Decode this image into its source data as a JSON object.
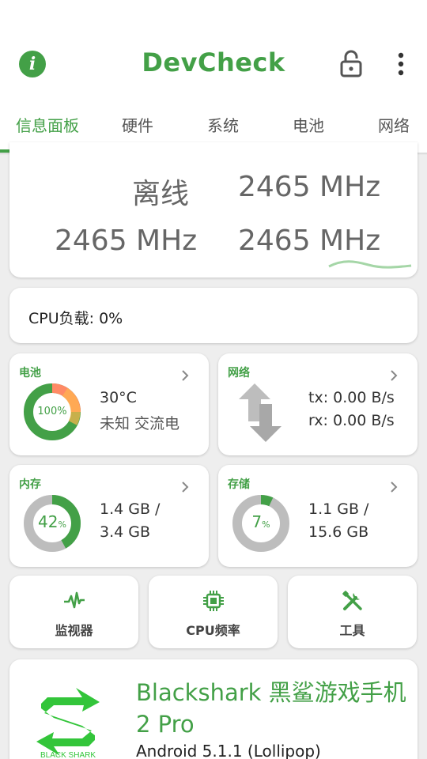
{
  "app": {
    "title": "DevCheck"
  },
  "toolbar": {
    "info_icon": "info-icon",
    "lock_icon": "lock-icon",
    "more_icon": "more-vert-icon"
  },
  "tabs": [
    {
      "label": "信息面板",
      "active": true
    },
    {
      "label": "硬件"
    },
    {
      "label": "系统"
    },
    {
      "label": "电池"
    },
    {
      "label": "网络"
    }
  ],
  "cpu_freq": {
    "cells": [
      "离线",
      "2465 MHz",
      "2465 MHz",
      "2465 MHz"
    ]
  },
  "cpu_load": {
    "text": "CPU负载: 0%"
  },
  "battery": {
    "label": "电池",
    "percent_text": "100%",
    "percent": 100,
    "temp": "30°C",
    "status": "未知 交流电"
  },
  "network": {
    "label": "网络",
    "tx": "tx: 0.00 B/s",
    "rx": "rx: 0.00 B/s"
  },
  "memory": {
    "label": "内存",
    "percent": 42,
    "percent_text": "42",
    "used": "1.4 GB /",
    "total": "3.4 GB"
  },
  "storage": {
    "label": "存储",
    "percent": 7,
    "percent_text": "7",
    "used": "1.1 GB /",
    "total": "15.6 GB"
  },
  "tools": [
    {
      "label": "监视器",
      "icon": "monitor-pulse-icon"
    },
    {
      "label": "CPU频率",
      "icon": "cpu-chip-icon"
    },
    {
      "label": "工具",
      "icon": "tools-icon"
    }
  ],
  "device": {
    "name": "Blackshark 黑鲨游戏手机 2 Pro",
    "os": "Android 5.1.1 (Lollipop)",
    "logo_text": "BLACK SHARK"
  },
  "colors": {
    "accent": "#43a047",
    "ring_track": "#bdbdbd",
    "battery_orange": "#ff8a65"
  }
}
